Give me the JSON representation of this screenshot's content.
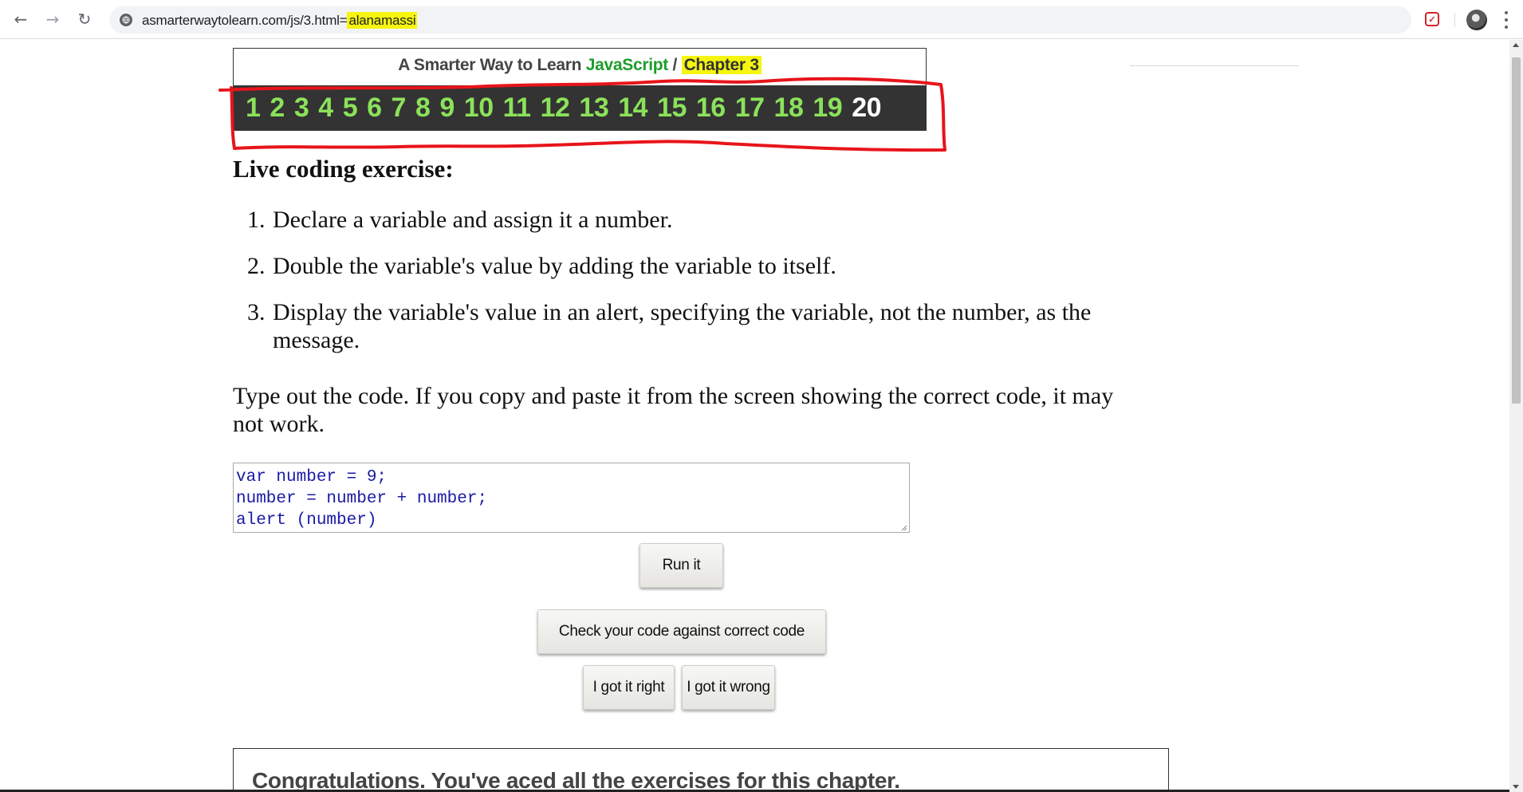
{
  "browser": {
    "url_prefix": "asmarterwaytolearn.com/js/3.html=",
    "url_highlight": "alanamassi",
    "extension_icon": "pocket-icon",
    "profile_icon": "avatar-icon"
  },
  "header": {
    "title_prefix": "A Smarter Way to Learn ",
    "title_brand": "JavaScript",
    "title_sep": " / ",
    "chapter_label": "Chapter 3",
    "brand_color": "#1f9d2b",
    "highlight_color": "#f5f50f",
    "chapters": [
      "1",
      "2",
      "3",
      "4",
      "5",
      "6",
      "7",
      "8",
      "9",
      "10",
      "11",
      "12",
      "13",
      "14",
      "15",
      "16",
      "17",
      "18",
      "19",
      "20"
    ],
    "current_chapter": "20"
  },
  "exercise": {
    "title": "Live coding exercise:",
    "steps": [
      {
        "num": "1.",
        "text": "Declare a variable and assign it a number."
      },
      {
        "num": "2.",
        "text": "Double the variable's value by adding the variable to itself."
      },
      {
        "num": "3.",
        "text": "Display the variable's value in an alert, specifying the variable, not the number, as the message."
      }
    ],
    "note": "Type out the code. If you copy and paste it from the screen showing the correct code, it may not work.",
    "code": "var number = 9;\nnumber = number + number;\nalert (number)"
  },
  "buttons": {
    "run": "Run it",
    "check": "Check your code against correct code",
    "right": "I got it right",
    "wrong": "I got it wrong"
  },
  "congrats": "Congratulations. You've aced all the exercises for this chapter."
}
